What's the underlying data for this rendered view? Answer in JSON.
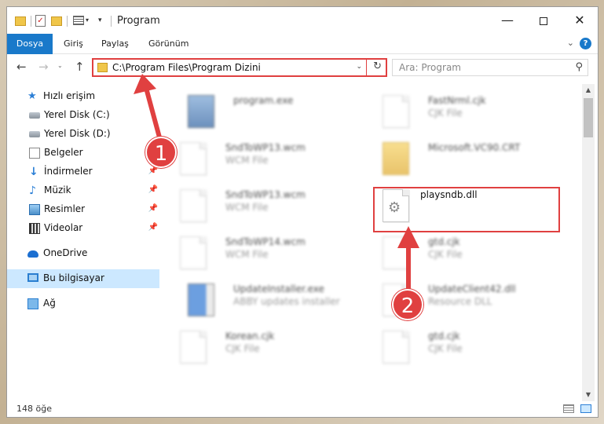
{
  "window": {
    "title": "Program",
    "minimize": "—",
    "close": "✕"
  },
  "ribbon": {
    "tabs": [
      {
        "label": "Dosya"
      },
      {
        "label": "Giriş"
      },
      {
        "label": "Paylaş"
      },
      {
        "label": "Görünüm"
      }
    ],
    "help": "?"
  },
  "navbar": {
    "back": "←",
    "forward": "→",
    "up": "↑",
    "address": "C:\\Program Files\\Program Dizini",
    "search_placeholder": "Ara: Program"
  },
  "sidebar": {
    "items": [
      {
        "label": "Hızlı erişim"
      },
      {
        "label": "Yerel Disk (C:)"
      },
      {
        "label": "Yerel Disk (D:)"
      },
      {
        "label": "Belgeler"
      },
      {
        "label": "İndirmeler"
      },
      {
        "label": "Müzik"
      },
      {
        "label": "Resimler"
      },
      {
        "label": "Videolar"
      },
      {
        "label": "OneDrive"
      },
      {
        "label": "Bu bilgisayar"
      },
      {
        "label": "Ağ"
      }
    ]
  },
  "files": [
    {
      "name": "program.exe",
      "type": ""
    },
    {
      "name": "FastNrml.cjk",
      "type": "CJK File"
    },
    {
      "name": "SndToWP13.wcm",
      "type": "WCM File"
    },
    {
      "name": "Microsoft.VC90.CRT",
      "type": ""
    },
    {
      "name": "SndToWP13.wcm",
      "type": "WCM File"
    },
    {
      "name": "playsndb.dll",
      "type": ""
    },
    {
      "name": "SndToWP14.wcm",
      "type": "WCM File"
    },
    {
      "name": "gtd.cjk",
      "type": "CJK File"
    },
    {
      "name": "UpdateInstaller.exe",
      "type": "ABBY updates installer"
    },
    {
      "name": "UpdateClient42.dll",
      "type": "Resource DLL"
    },
    {
      "name": "Korean.cjk",
      "type": "CJK File"
    },
    {
      "name": "gtd.cjk",
      "type": "CJK File"
    }
  ],
  "status": {
    "count": "148 öğe"
  },
  "annotations": {
    "step1": "1",
    "step2": "2",
    "color": "#e04040"
  }
}
